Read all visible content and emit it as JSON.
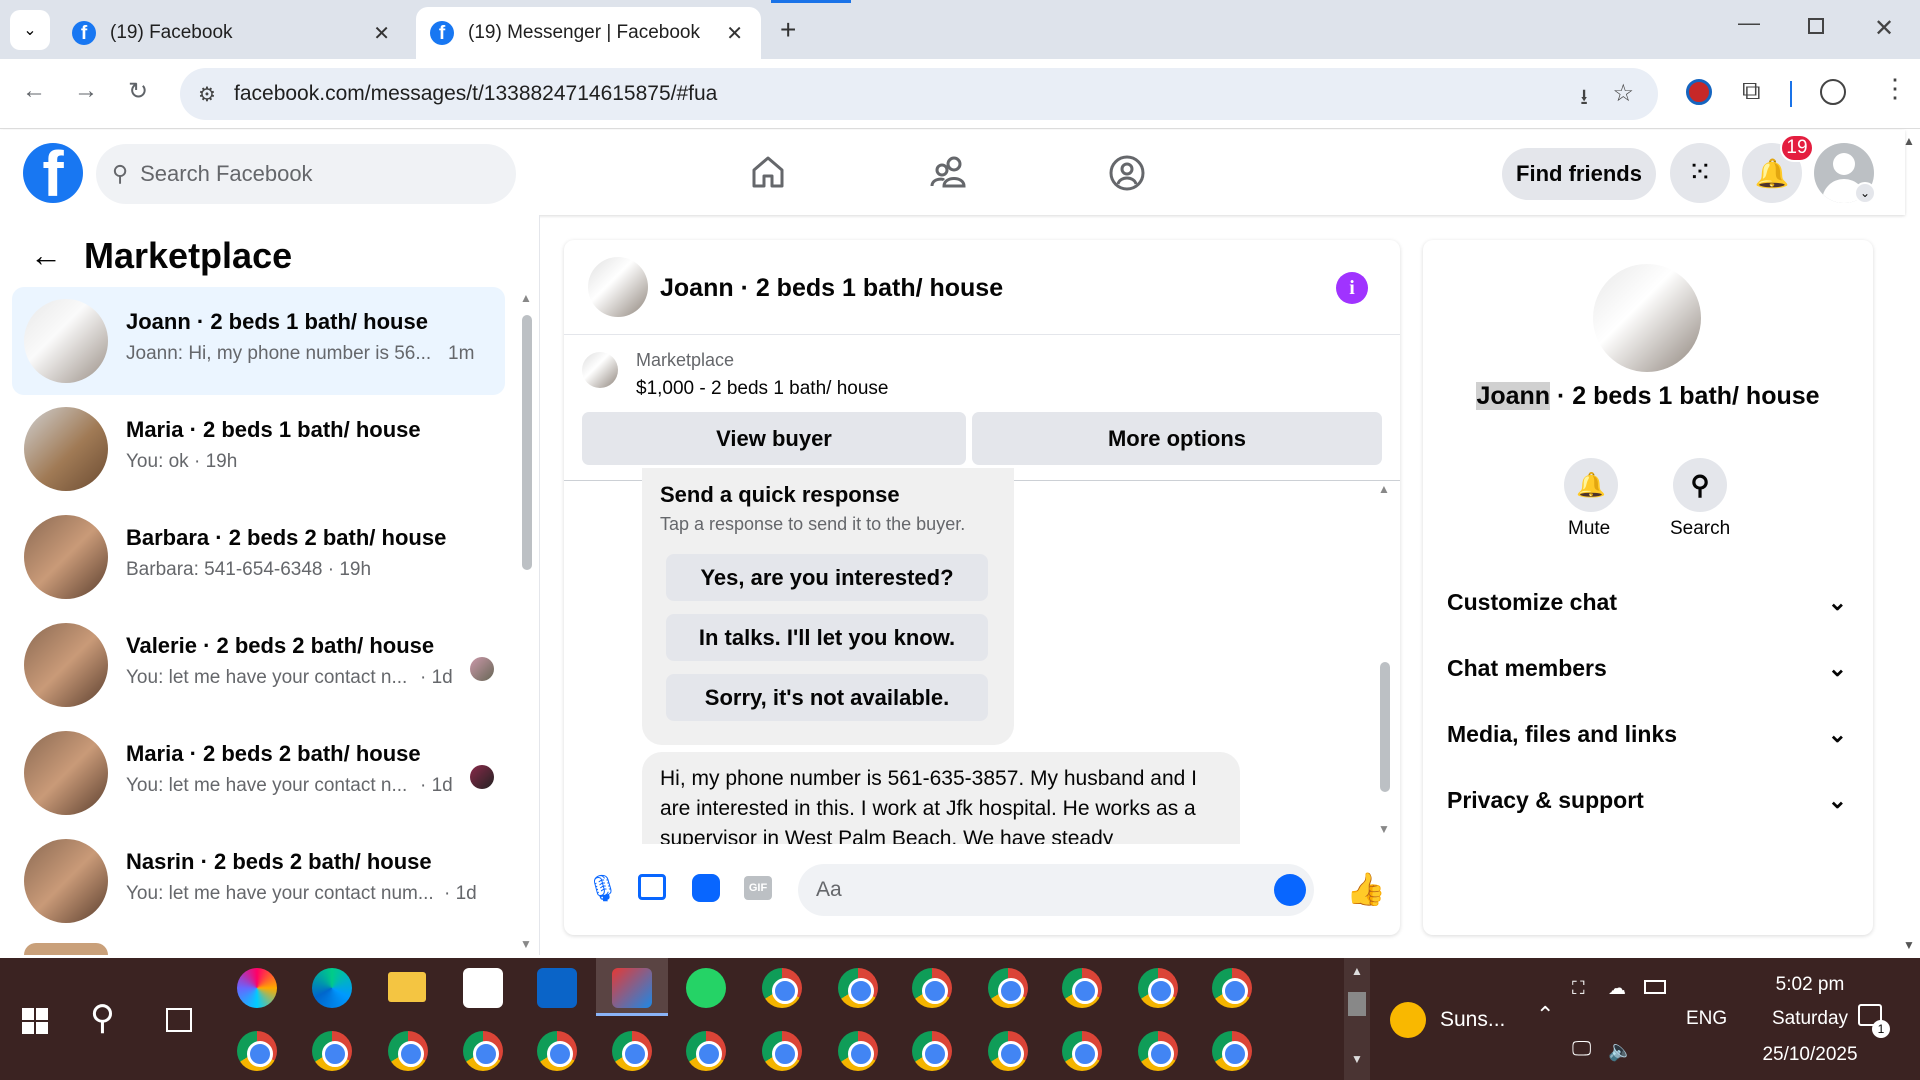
{
  "browser": {
    "tabs": [
      {
        "title": "(19) Facebook",
        "active": false
      },
      {
        "title": "(19) Messenger | Facebook",
        "active": true
      }
    ],
    "url": "facebook.com/messages/t/1338824714615875/#fua"
  },
  "fb_header": {
    "search_placeholder": "Search Facebook",
    "find_friends": "Find friends",
    "notification_count": "19"
  },
  "left": {
    "title": "Marketplace",
    "conversations": [
      {
        "title": "Joann · 2 beds 1 bath/ house",
        "snippet": "Joann: Hi, my phone number is 56...",
        "time": "1m",
        "selected": true
      },
      {
        "title": "Maria · 2 beds 1 bath/ house",
        "snippet": "You: ok · 19h",
        "time": ""
      },
      {
        "title": "Barbara · 2 beds 2 bath/ house",
        "snippet": "Barbara: 541-654-6348 · 19h",
        "time": ""
      },
      {
        "title": "Valerie · 2 beds 2 bath/ house",
        "snippet": "You: let me have your contact n...",
        "time": "· 1d"
      },
      {
        "title": "Maria · 2 beds 2 bath/ house",
        "snippet": "You: let me have your contact n...",
        "time": "· 1d"
      },
      {
        "title": "Nasrin · 2 beds 2 bath/ house",
        "snippet": "You: let me have your contact num...",
        "time": "· 1d"
      }
    ]
  },
  "chat": {
    "title": "Joann · 2 beds 1 bath/ house",
    "listing_source": "Marketplace",
    "listing_desc": "$1,000 - 2 beds 1 bath/ house",
    "view_buyer": "View buyer",
    "more_options": "More options",
    "quick_title": "Send a quick response",
    "quick_sub": "Tap a response to send it to the buyer.",
    "quick_replies": [
      "Yes, are you interested?",
      "In talks. I'll let you know.",
      "Sorry, it's not available."
    ],
    "message": "Hi, my phone number is 561-635-3857. My husband and I are interested in this. I work at Jfk hospital. He works as a supervisor in West Palm Beach. We have steady",
    "composer_placeholder": "Aa"
  },
  "details": {
    "name_highlight": "Joann",
    "name_rest": " · 2 beds 1 bath/ house",
    "mute": "Mute",
    "search": "Search",
    "sections": [
      "Customize chat",
      "Chat members",
      "Media, files and links",
      "Privacy & support"
    ]
  },
  "taskbar": {
    "weather": "Suns...",
    "lang": "ENG",
    "time": "5:02 pm",
    "day": "Saturday",
    "date": "25/10/2025",
    "notif_count": "1"
  }
}
